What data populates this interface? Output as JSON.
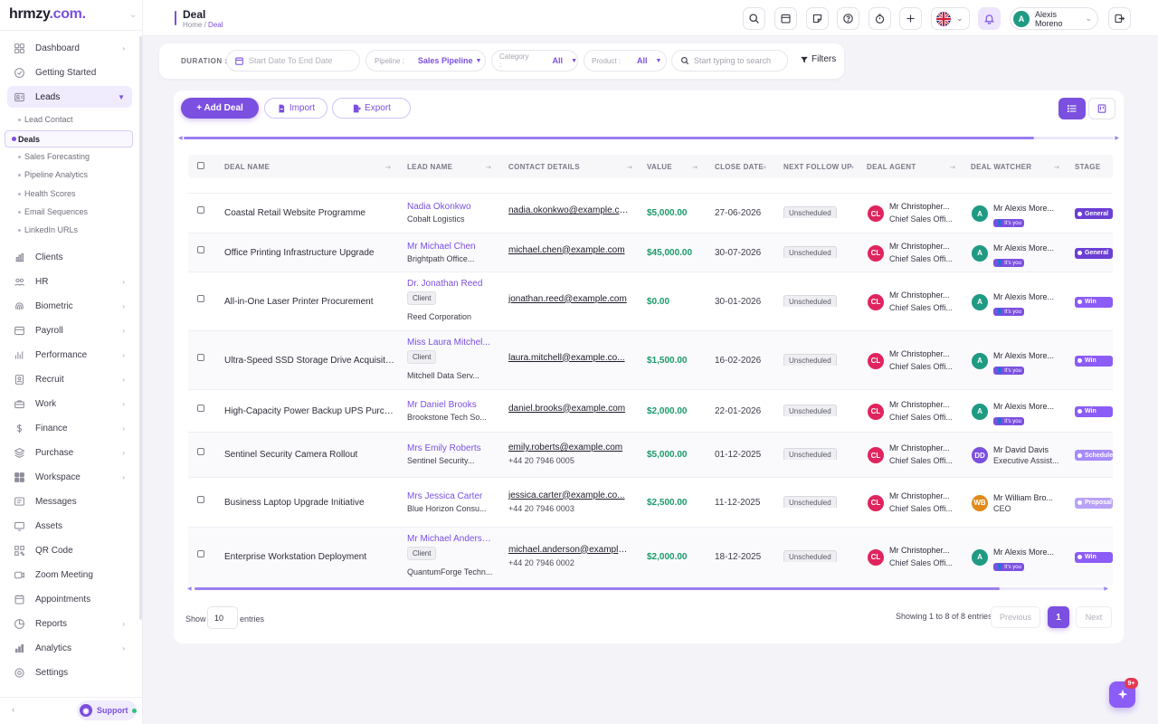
{
  "brand": {
    "logo_text": "hrmzy",
    "logo_suffix": ".com."
  },
  "sidebar": {
    "items": [
      {
        "label": "Dashboard",
        "icon": "dashboard-icon",
        "chevron": true
      },
      {
        "label": "Getting Started",
        "icon": "compass-icon",
        "chevron": false
      },
      {
        "label": "Leads",
        "icon": "leads-icon",
        "chevron": true,
        "active": true
      },
      {
        "label": "Clients",
        "icon": "clients-icon",
        "chevron": false
      },
      {
        "label": "HR",
        "icon": "hr-icon",
        "chevron": true
      },
      {
        "label": "Biometric",
        "icon": "fingerprint-icon",
        "chevron": true
      },
      {
        "label": "Payroll",
        "icon": "payroll-icon",
        "chevron": true
      },
      {
        "label": "Performance",
        "icon": "performance-icon",
        "chevron": true
      },
      {
        "label": "Recruit",
        "icon": "recruit-icon",
        "chevron": true
      },
      {
        "label": "Work",
        "icon": "briefcase-icon",
        "chevron": true
      },
      {
        "label": "Finance",
        "icon": "dollar-icon",
        "chevron": true
      },
      {
        "label": "Purchase",
        "icon": "purchase-icon",
        "chevron": true
      },
      {
        "label": "Workspace",
        "icon": "workspace-icon",
        "chevron": true
      },
      {
        "label": "Messages",
        "icon": "messages-icon",
        "chevron": false
      },
      {
        "label": "Assets",
        "icon": "monitor-icon",
        "chevron": false
      },
      {
        "label": "QR Code",
        "icon": "qr-icon",
        "chevron": false
      },
      {
        "label": "Zoom Meeting",
        "icon": "video-icon",
        "chevron": false
      },
      {
        "label": "Appointments",
        "icon": "calendar-icon",
        "chevron": false
      },
      {
        "label": "Reports",
        "icon": "reports-icon",
        "chevron": true
      },
      {
        "label": "Analytics",
        "icon": "analytics-icon",
        "chevron": true
      },
      {
        "label": "Settings",
        "icon": "settings-icon",
        "chevron": false
      }
    ],
    "leads_sub": [
      {
        "label": "Lead Contact",
        "active": false
      },
      {
        "label": "Deals",
        "active": true
      },
      {
        "label": "Sales Forecasting",
        "active": false
      },
      {
        "label": "Pipeline Analytics",
        "active": false
      },
      {
        "label": "Health Scores",
        "active": false
      },
      {
        "label": "Email Sequences",
        "active": false
      },
      {
        "label": "LinkedIn URLs",
        "active": false
      }
    ],
    "support_label": "Support"
  },
  "header": {
    "title": "Deal",
    "breadcrumb_home": "Home",
    "breadcrumb_sep": "/",
    "breadcrumb_current": "Deal",
    "user_name": "Alexis Moreno",
    "user_initial": "A"
  },
  "filters": {
    "duration_label": "DURATION :",
    "date_placeholder": "Start Date To End Date",
    "pipeline_key": "Pipeline :",
    "pipeline_value": "Sales Pipeline",
    "category_key": "Category :",
    "category_value": "All",
    "product_key": "Product :",
    "product_value": "All",
    "search_placeholder": "Start typing to search",
    "filters_label": "Filters"
  },
  "toolbar": {
    "add_label": "+ Add Deal",
    "import_label": "Import",
    "export_label": "Export"
  },
  "table": {
    "columns": [
      "DEAL NAME",
      "LEAD NAME",
      "CONTACT DETAILS",
      "VALUE",
      "CLOSE DATE",
      "NEXT FOLLOW UP",
      "DEAL AGENT",
      "DEAL WATCHER",
      "STAGE"
    ],
    "its_you": "It's you",
    "rows": [
      {
        "deal": "Coastal Retail Website Programme",
        "lead": "Nadia Okonkwo",
        "client": false,
        "company": "Cobalt Logistics",
        "email": "nadia.okonkwo@example.com",
        "phone": "",
        "value": "$5,000.00",
        "close": "27-06-2026",
        "followup": "Unscheduled",
        "agent_initials": "CL",
        "agent_name": "Mr Christopher...",
        "agent_role": "Chief Sales Offi...",
        "watcher_initials": "A",
        "watcher_name": "Mr Alexis More...",
        "watcher_you": true,
        "watcher_role": "",
        "stage": "General",
        "stage_color": "#6b3fd4"
      },
      {
        "deal": "Office Printing Infrastructure Upgrade",
        "lead": "Mr Michael Chen",
        "client": false,
        "company": "Brightpath Office...",
        "email": "michael.chen@example.com",
        "phone": "",
        "value": "$45,000.00",
        "close": "30-07-2026",
        "followup": "Unscheduled",
        "agent_initials": "CL",
        "agent_name": "Mr Christopher...",
        "agent_role": "Chief Sales Offi...",
        "watcher_initials": "A",
        "watcher_name": "Mr Alexis More...",
        "watcher_you": true,
        "watcher_role": "",
        "stage": "General",
        "stage_color": "#6b3fd4"
      },
      {
        "deal": "All-in-One Laser Printer Procurement",
        "lead": "Dr. Jonathan Reed",
        "client": true,
        "company": "Reed Corporation",
        "email": "jonathan.reed@example.com",
        "phone": "",
        "value": "$0.00",
        "close": "30-01-2026",
        "followup": "Unscheduled",
        "agent_initials": "CL",
        "agent_name": "Mr Christopher...",
        "agent_role": "Chief Sales Offi...",
        "watcher_initials": "A",
        "watcher_name": "Mr Alexis More...",
        "watcher_you": true,
        "watcher_role": "",
        "stage": "Win",
        "stage_color": "#8b5cf6"
      },
      {
        "deal": "Ultra-Speed SSD Storage Drive Acquisition",
        "lead": "Miss Laura Mitchel...",
        "client": true,
        "company": "Mitchell Data Serv...",
        "email": "laura.mitchell@example.co...",
        "phone": "",
        "value": "$1,500.00",
        "close": "16-02-2026",
        "followup": "Unscheduled",
        "agent_initials": "CL",
        "agent_name": "Mr Christopher...",
        "agent_role": "Chief Sales Offi...",
        "watcher_initials": "A",
        "watcher_name": "Mr Alexis More...",
        "watcher_you": true,
        "watcher_role": "",
        "stage": "Win",
        "stage_color": "#8b5cf6"
      },
      {
        "deal": "High-Capacity Power Backup UPS Purchase",
        "lead": "Mr Daniel Brooks",
        "client": false,
        "company": "Brookstone Tech So...",
        "email": "daniel.brooks@example.com",
        "phone": "",
        "value": "$2,000.00",
        "close": "22-01-2026",
        "followup": "Unscheduled",
        "agent_initials": "CL",
        "agent_name": "Mr Christopher...",
        "agent_role": "Chief Sales Offi...",
        "watcher_initials": "A",
        "watcher_name": "Mr Alexis More...",
        "watcher_you": true,
        "watcher_role": "",
        "stage": "Win",
        "stage_color": "#8b5cf6"
      },
      {
        "deal": "Sentinel Security Camera Rollout",
        "lead": "Mrs Emily Roberts",
        "client": false,
        "company": "Sentinel Security...",
        "email": "emily.roberts@example.com",
        "phone": "+44 20 7946 0005",
        "value": "$5,000.00",
        "close": "01-12-2025",
        "followup": "Unscheduled",
        "agent_initials": "CL",
        "agent_name": "Mr Christopher...",
        "agent_role": "Chief Sales Offi...",
        "watcher_initials": "DD",
        "watcher_name": "Mr David Davis",
        "watcher_you": false,
        "watcher_role": "Executive Assist...",
        "stage": "Scheduled",
        "stage_color": "#a78bfa"
      },
      {
        "deal": "Business Laptop Upgrade Initiative",
        "lead": "Mrs Jessica Carter",
        "client": false,
        "company": "Blue Horizon Consu...",
        "email": "jessica.carter@example.co...",
        "phone": "+44 20 7946 0003",
        "value": "$2,500.00",
        "close": "11-12-2025",
        "followup": "Unscheduled",
        "agent_initials": "CL",
        "agent_name": "Mr Christopher...",
        "agent_role": "Chief Sales Offi...",
        "watcher_initials": "WB",
        "watcher_name": "Mr William Bro...",
        "watcher_you": false,
        "watcher_role": "CEO",
        "stage": "Proposal",
        "stage_color": "#b9a2f5"
      },
      {
        "deal": "Enterprise Workstation Deployment",
        "lead": "Mr Michael Anderso...",
        "client": true,
        "company": "QuantumForge Techn...",
        "email": "michael.anderson@example....",
        "phone": "+44 20 7946 0002",
        "value": "$2,000.00",
        "close": "18-12-2025",
        "followup": "Unscheduled",
        "agent_initials": "CL",
        "agent_name": "Mr Christopher...",
        "agent_role": "Chief Sales Offi...",
        "watcher_initials": "A",
        "watcher_name": "Mr Alexis More...",
        "watcher_you": true,
        "watcher_role": "",
        "stage": "Win",
        "stage_color": "#8b5cf6"
      }
    ]
  },
  "pagination": {
    "show_label": "Show",
    "entries_label": "entries",
    "page_size": "10",
    "showing": "Showing 1 to 8 of 8 entries",
    "previous": "Previous",
    "page": "1",
    "next": "Next"
  },
  "fab_badge": "9+",
  "colors": {
    "accent": "#7b4fe0",
    "value_green": "#1a9a6a",
    "agent_avatar": "#e0245e",
    "watcher_avatar": "#1f9a83",
    "dd_avatar": "#7b4fe0",
    "wb_avatar": "#e08a1a"
  }
}
